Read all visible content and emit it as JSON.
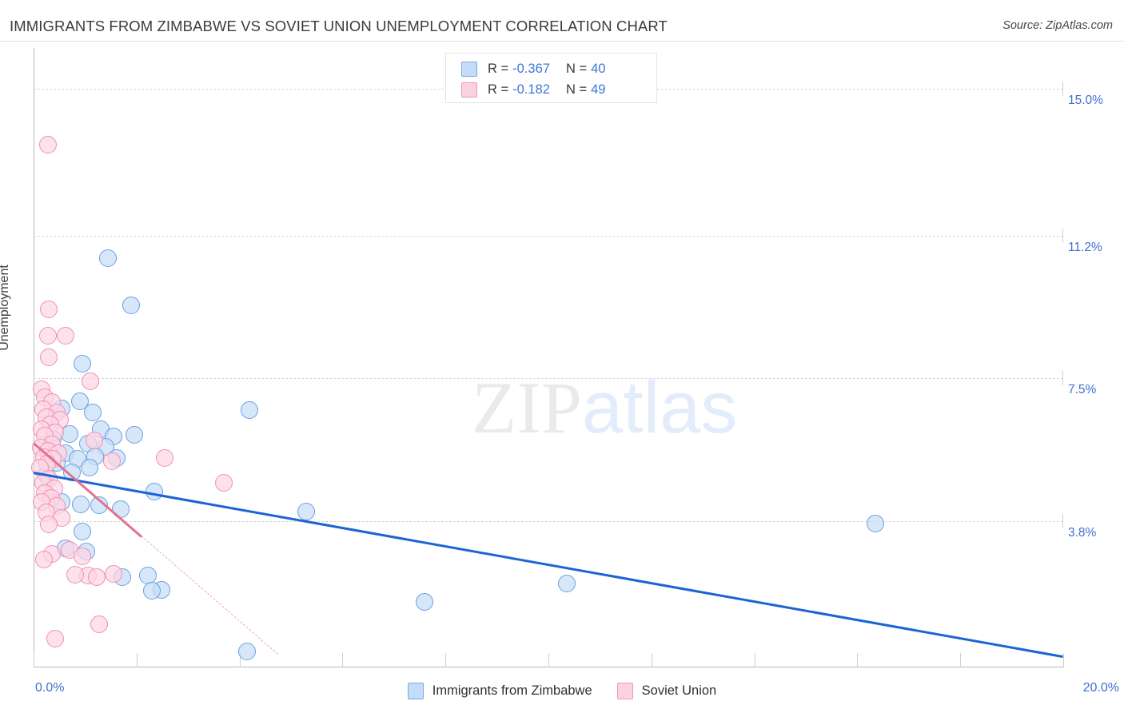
{
  "header": {
    "title": "IMMIGRANTS FROM ZIMBABWE VS SOVIET UNION UNEMPLOYMENT CORRELATION CHART",
    "source": "Source: ZipAtlas.com"
  },
  "watermark": {
    "part1": "ZIP",
    "part2": "atlas"
  },
  "correlation": {
    "rows": [
      {
        "series": "Immigrants from Zimbabwe",
        "r_label": "R =",
        "r_value": "-0.367",
        "n_label": "N =",
        "n_value": "40",
        "color": "#c3dcf7"
      },
      {
        "series": "Soviet Union",
        "r_label": "R =",
        "r_value": "-0.182",
        "n_label": "N =",
        "n_value": "49",
        "color": "#fbd3e0"
      }
    ]
  },
  "legend": {
    "items": [
      {
        "label": "Immigrants from Zimbabwe",
        "color": "#c3dcf7"
      },
      {
        "label": "Soviet Union",
        "color": "#fbd3e0"
      }
    ]
  },
  "axes": {
    "y_title": "Unemployment",
    "y_ticks": [
      "15.0%",
      "11.2%",
      "7.5%",
      "3.8%"
    ],
    "x_min_label": "0.0%",
    "x_max_label": "20.0%"
  },
  "chart_data": {
    "type": "scatter",
    "title": "IMMIGRANTS FROM ZIMBABWE VS SOVIET UNION UNEMPLOYMENT CORRELATION CHART",
    "xlabel": "Immigrants from Zimbabwe",
    "ylabel": "Unemployment",
    "xlim": [
      0,
      20
    ],
    "ylim": [
      0,
      16.06
    ],
    "x_tick_labels": [
      "0.0%",
      "20.0%"
    ],
    "y_tick_labels": [
      "3.8%",
      "7.5%",
      "11.2%",
      "15.0%"
    ],
    "y_tick_values": [
      3.8,
      7.5,
      11.2,
      15.0
    ],
    "grid": "horizontal-dashed",
    "legend_position": "bottom-center",
    "series": [
      {
        "name": "Immigrants from Zimbabwe",
        "color": "#c6def7",
        "edge_color": "#6b9fe0",
        "r": -0.367,
        "n": 40,
        "trendline": {
          "x0": 0.0,
          "y0": 5.07,
          "x1": 20.0,
          "y1": 0.3,
          "style": "solid"
        },
        "points": [
          {
            "x": 1.45,
            "y": 10.62
          },
          {
            "x": 1.9,
            "y": 9.38
          },
          {
            "x": 0.95,
            "y": 7.88
          },
          {
            "x": 4.2,
            "y": 6.68
          },
          {
            "x": 0.9,
            "y": 6.9
          },
          {
            "x": 1.15,
            "y": 6.62
          },
          {
            "x": 0.55,
            "y": 6.72
          },
          {
            "x": 1.3,
            "y": 6.18
          },
          {
            "x": 1.95,
            "y": 6.02
          },
          {
            "x": 1.55,
            "y": 5.98
          },
          {
            "x": 0.7,
            "y": 6.05
          },
          {
            "x": 1.05,
            "y": 5.8
          },
          {
            "x": 0.38,
            "y": 5.92
          },
          {
            "x": 1.4,
            "y": 5.72
          },
          {
            "x": 0.3,
            "y": 5.6
          },
          {
            "x": 0.62,
            "y": 5.55
          },
          {
            "x": 1.2,
            "y": 5.48
          },
          {
            "x": 0.85,
            "y": 5.4
          },
          {
            "x": 1.62,
            "y": 5.42
          },
          {
            "x": 0.45,
            "y": 5.3
          },
          {
            "x": 1.08,
            "y": 5.18
          },
          {
            "x": 0.75,
            "y": 5.05
          },
          {
            "x": 0.25,
            "y": 5.0
          },
          {
            "x": 2.35,
            "y": 4.55
          },
          {
            "x": 0.55,
            "y": 4.28
          },
          {
            "x": 0.92,
            "y": 4.22
          },
          {
            "x": 1.28,
            "y": 4.2
          },
          {
            "x": 1.7,
            "y": 4.1
          },
          {
            "x": 5.3,
            "y": 4.05
          },
          {
            "x": 16.35,
            "y": 3.72
          },
          {
            "x": 0.95,
            "y": 3.52
          },
          {
            "x": 0.62,
            "y": 3.08
          },
          {
            "x": 1.02,
            "y": 3.0
          },
          {
            "x": 1.72,
            "y": 2.35
          },
          {
            "x": 2.22,
            "y": 2.38
          },
          {
            "x": 2.48,
            "y": 2.02
          },
          {
            "x": 2.3,
            "y": 1.98
          },
          {
            "x": 7.6,
            "y": 1.7
          },
          {
            "x": 10.35,
            "y": 2.18
          },
          {
            "x": 4.15,
            "y": 0.42
          }
        ]
      },
      {
        "name": "Soviet Union",
        "color": "#fcd6e3",
        "edge_color": "#ef8fb2",
        "r": -0.182,
        "n": 49,
        "trendline": {
          "x0": 0.0,
          "y0": 5.85,
          "x1": 2.1,
          "y1": 3.42,
          "style": "solid"
        },
        "trendline_extension": {
          "x0": 2.1,
          "y0": 3.42,
          "x1": 4.75,
          "y1": 0.35,
          "style": "dashed"
        },
        "points": [
          {
            "x": 0.28,
            "y": 13.55
          },
          {
            "x": 0.3,
            "y": 9.28
          },
          {
            "x": 0.28,
            "y": 8.6
          },
          {
            "x": 0.62,
            "y": 8.6
          },
          {
            "x": 0.3,
            "y": 8.05
          },
          {
            "x": 1.1,
            "y": 7.42
          },
          {
            "x": 0.15,
            "y": 7.22
          },
          {
            "x": 0.22,
            "y": 7.0
          },
          {
            "x": 0.35,
            "y": 6.88
          },
          {
            "x": 0.18,
            "y": 6.7
          },
          {
            "x": 0.45,
            "y": 6.62
          },
          {
            "x": 0.25,
            "y": 6.48
          },
          {
            "x": 0.52,
            "y": 6.42
          },
          {
            "x": 0.32,
            "y": 6.3
          },
          {
            "x": 0.16,
            "y": 6.18
          },
          {
            "x": 0.42,
            "y": 6.1
          },
          {
            "x": 0.22,
            "y": 6.0
          },
          {
            "x": 1.18,
            "y": 5.88
          },
          {
            "x": 0.35,
            "y": 5.78
          },
          {
            "x": 0.14,
            "y": 5.7
          },
          {
            "x": 0.28,
            "y": 5.62
          },
          {
            "x": 0.48,
            "y": 5.55
          },
          {
            "x": 0.2,
            "y": 5.46
          },
          {
            "x": 0.38,
            "y": 5.4
          },
          {
            "x": 1.52,
            "y": 5.35
          },
          {
            "x": 0.26,
            "y": 5.28
          },
          {
            "x": 0.12,
            "y": 5.18
          },
          {
            "x": 2.55,
            "y": 5.42
          },
          {
            "x": 3.7,
            "y": 4.78
          },
          {
            "x": 0.3,
            "y": 4.9
          },
          {
            "x": 0.18,
            "y": 4.78
          },
          {
            "x": 0.4,
            "y": 4.65
          },
          {
            "x": 0.22,
            "y": 4.52
          },
          {
            "x": 0.34,
            "y": 4.4
          },
          {
            "x": 0.15,
            "y": 4.28
          },
          {
            "x": 0.45,
            "y": 4.18
          },
          {
            "x": 0.25,
            "y": 4.02
          },
          {
            "x": 0.55,
            "y": 3.88
          },
          {
            "x": 0.3,
            "y": 3.7
          },
          {
            "x": 0.7,
            "y": 3.05
          },
          {
            "x": 0.35,
            "y": 2.95
          },
          {
            "x": 0.95,
            "y": 2.88
          },
          {
            "x": 0.2,
            "y": 2.8
          },
          {
            "x": 1.05,
            "y": 2.38
          },
          {
            "x": 1.22,
            "y": 2.35
          },
          {
            "x": 1.55,
            "y": 2.42
          },
          {
            "x": 0.8,
            "y": 2.4
          },
          {
            "x": 1.28,
            "y": 1.12
          },
          {
            "x": 0.42,
            "y": 0.75
          }
        ]
      }
    ]
  }
}
